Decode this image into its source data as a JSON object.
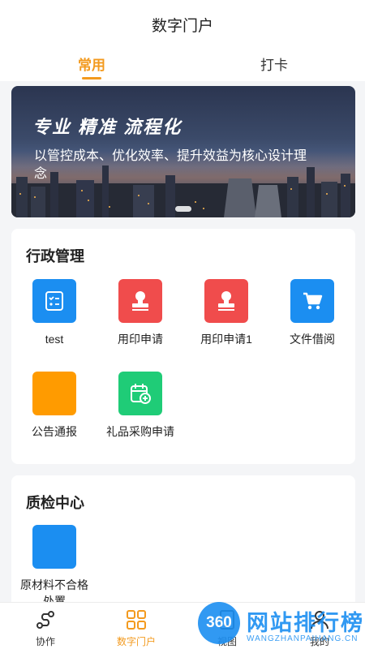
{
  "header": {
    "title": "数字门户"
  },
  "tabs": [
    {
      "label": "常用",
      "active": true
    },
    {
      "label": "打卡",
      "active": false
    }
  ],
  "banner": {
    "slogan": "专业 精准 流程化",
    "description": "以管控成本、优化效率、提升效益为核心设计理念"
  },
  "sections": {
    "admin": {
      "title": "行政管理",
      "apps": [
        {
          "label": "test",
          "icon": "checklist-icon",
          "color": "#1b8ef1"
        },
        {
          "label": "用印申请",
          "icon": "stamp-icon",
          "color": "#f04c4c"
        },
        {
          "label": "用印申请1",
          "icon": "stamp-icon",
          "color": "#f04c4c"
        },
        {
          "label": "文件借阅",
          "icon": "cart-icon",
          "color": "#1b8ef1"
        },
        {
          "label": "公告通报",
          "icon": "blank-icon",
          "color": "#ff9b00"
        },
        {
          "label": "礼品采购申请",
          "icon": "calendar-add-icon",
          "color": "#1fcc77"
        }
      ]
    },
    "quality": {
      "title": "质检中心",
      "apps": [
        {
          "label": "原材料不合格处置",
          "icon": "blank-icon",
          "color": "#1b8ef1"
        }
      ]
    }
  },
  "tabbar": [
    {
      "label": "协作",
      "icon": "route-icon",
      "active": false
    },
    {
      "label": "数字门户",
      "icon": "grid-icon",
      "active": true
    },
    {
      "label": "视图",
      "icon": "tablet-icon",
      "active": false
    },
    {
      "label": "我的",
      "icon": "user-icon",
      "active": false
    }
  ],
  "watermark": {
    "badge": "360",
    "text": "网站排行榜",
    "sub": "WANGZHANPAIHANG.CN"
  },
  "colors": {
    "accent": "#f39a1e",
    "blue": "#1b8ef1",
    "red": "#f04c4c",
    "green": "#1fcc77",
    "orange": "#ff9b00"
  }
}
